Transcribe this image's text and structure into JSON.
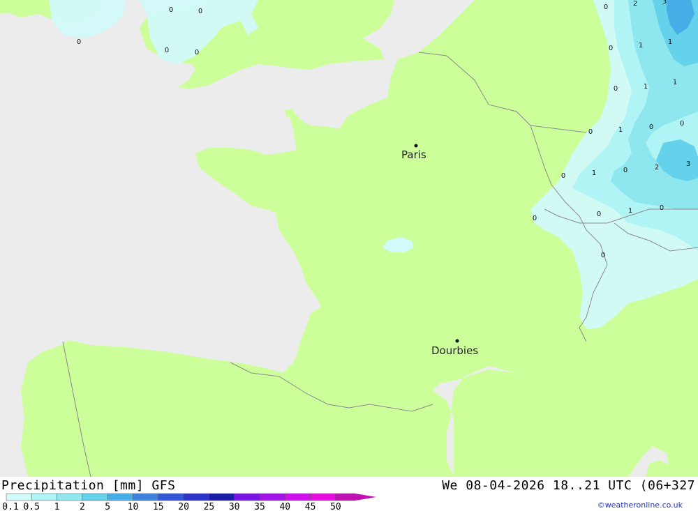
{
  "title": "Precipitation [mm] GFS",
  "datetime": "We 08-04-2026 18..21 UTC (06+327",
  "credit": "©weatheronline.co.uk",
  "colors": {
    "sea": "#ececec",
    "land": "#ccff99",
    "border": "#8a8a8a",
    "p01": "#d2fafa",
    "p05": "#b0f4f6",
    "p1": "#8ee6ee",
    "p2": "#63d2ea",
    "p5": "#45aee6"
  },
  "cities": [
    {
      "name": "Paris"
    },
    {
      "name": "Dourbies"
    }
  ],
  "legend": {
    "levels": [
      "0.1",
      "0.5",
      "1",
      "2",
      "5",
      "10",
      "15",
      "20",
      "25",
      "30",
      "35",
      "40",
      "45",
      "50"
    ],
    "colors": [
      "#d2fafa",
      "#b0f4f6",
      "#8ee6ee",
      "#63d2ea",
      "#45aee6",
      "#3e82e0",
      "#3456d8",
      "#2a34c8",
      "#1c1ca8",
      "#7a14e6",
      "#a412ea",
      "#d010ee",
      "#e80ee0",
      "#c012b4"
    ]
  },
  "values": [
    "0",
    "0",
    "0",
    "0",
    "0",
    "0",
    "2",
    "3",
    "0",
    "1",
    "1",
    "0",
    "1",
    "1",
    "0",
    "1",
    "0",
    "0",
    "0",
    "1",
    "0",
    "2",
    "3",
    "0",
    "0",
    "1",
    "0",
    "0",
    "0"
  ]
}
